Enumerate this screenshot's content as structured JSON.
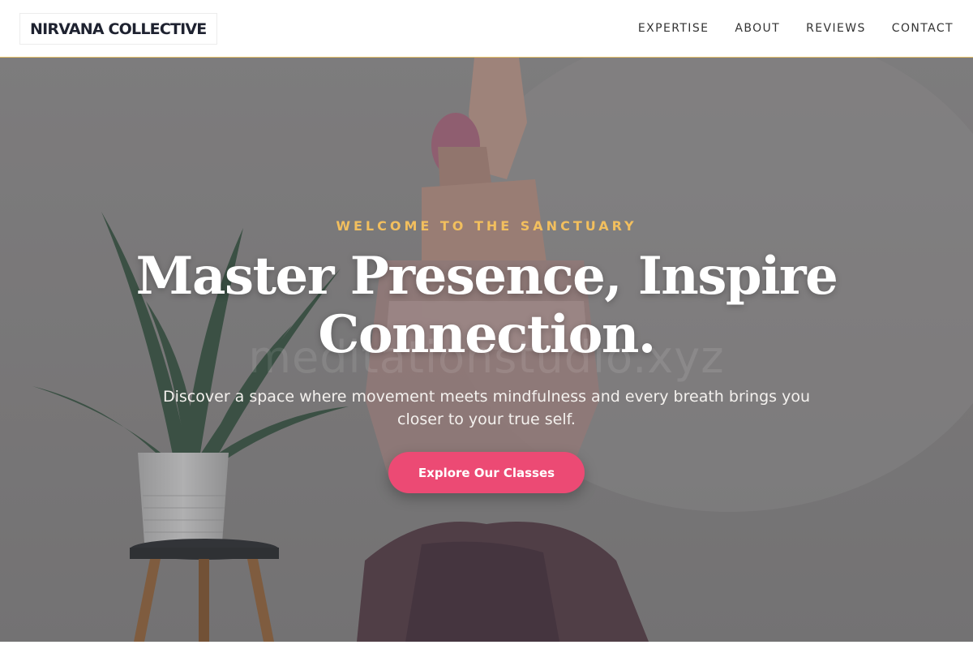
{
  "brand": {
    "name": "NIRVANA COLLECTIVE"
  },
  "nav": {
    "items": [
      {
        "label": "EXPERTISE"
      },
      {
        "label": "ABOUT"
      },
      {
        "label": "REVIEWS"
      },
      {
        "label": "CONTACT"
      }
    ]
  },
  "hero": {
    "eyebrow": "WELCOME TO THE SANCTUARY",
    "title": "Master Presence, Inspire Connection.",
    "watermark": "meditationstudio.xyz",
    "subtitle": "Discover a space where movement meets mindfulness and every breath brings you closer to your true self.",
    "cta_label": "Explore Our Classes"
  },
  "colors": {
    "accent_gold": "#f2bf5e",
    "cta_pink": "#ec4a74",
    "header_border": "#e8c36a",
    "logo_text": "#1e2230"
  },
  "icons": {
    "hero_image": "yoga-woman-with-aloe-plant-photo"
  }
}
